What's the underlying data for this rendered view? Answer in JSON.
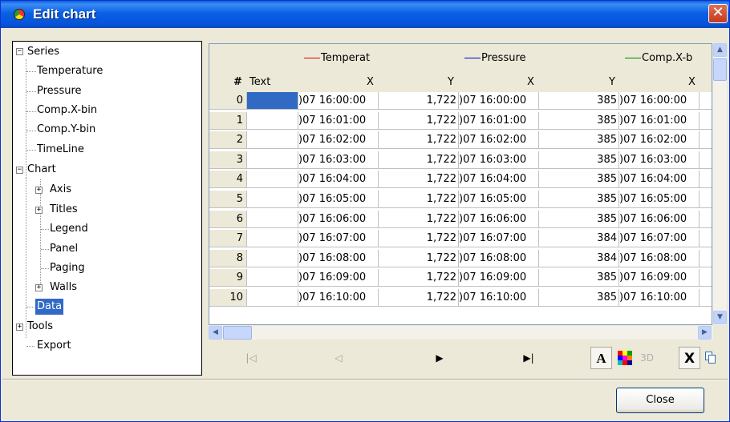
{
  "window": {
    "title": "Edit chart",
    "close_glyph": "✕"
  },
  "tree": {
    "series_label": "Series",
    "series": [
      "Temperature",
      "Pressure",
      "Comp.X-bin",
      "Comp.Y-bin",
      "TimeLine"
    ],
    "chart_label": "Chart",
    "chart_children": [
      "Axis",
      "Titles",
      "Legend",
      "Panel",
      "Paging",
      "Walls"
    ],
    "data_label": "Data",
    "tools_label": "Tools",
    "export_label": "Export"
  },
  "grid": {
    "series_headers": [
      {
        "name": "Temperat",
        "color": "#e00000"
      },
      {
        "name": "Pressure",
        "color": "#0000d0"
      },
      {
        "name": "Comp.X-b",
        "color": "#008000"
      }
    ],
    "col_headers": {
      "hash": "#",
      "text": "Text",
      "x": "X",
      "y": "Y"
    },
    "rows": [
      {
        "n": "0",
        "x1": ")07 16:00:00",
        "y1": "1,722",
        "x2": ")07 16:00:00",
        "y2": "385",
        "x3": ")07 16:00:00"
      },
      {
        "n": "1",
        "x1": ")07 16:01:00",
        "y1": "1,722",
        "x2": ")07 16:01:00",
        "y2": "385",
        "x3": ")07 16:01:00"
      },
      {
        "n": "2",
        "x1": ")07 16:02:00",
        "y1": "1,722",
        "x2": ")07 16:02:00",
        "y2": "385",
        "x3": ")07 16:02:00"
      },
      {
        "n": "3",
        "x1": ")07 16:03:00",
        "y1": "1,722",
        "x2": ")07 16:03:00",
        "y2": "385",
        "x3": ")07 16:03:00"
      },
      {
        "n": "4",
        "x1": ")07 16:04:00",
        "y1": "1,722",
        "x2": ")07 16:04:00",
        "y2": "385",
        "x3": ")07 16:04:00"
      },
      {
        "n": "5",
        "x1": ")07 16:05:00",
        "y1": "1,722",
        "x2": ")07 16:05:00",
        "y2": "385",
        "x3": ")07 16:05:00"
      },
      {
        "n": "6",
        "x1": ")07 16:06:00",
        "y1": "1,722",
        "x2": ")07 16:06:00",
        "y2": "385",
        "x3": ")07 16:06:00"
      },
      {
        "n": "7",
        "x1": ")07 16:07:00",
        "y1": "1,722",
        "x2": ")07 16:07:00",
        "y2": "384",
        "x3": ")07 16:07:00"
      },
      {
        "n": "8",
        "x1": ")07 16:08:00",
        "y1": "1,722",
        "x2": ")07 16:08:00",
        "y2": "384",
        "x3": ")07 16:08:00"
      },
      {
        "n": "9",
        "x1": ")07 16:09:00",
        "y1": "1,722",
        "x2": ")07 16:09:00",
        "y2": "385",
        "x3": ")07 16:09:00"
      },
      {
        "n": "10",
        "x1": ")07 16:10:00",
        "y1": "1,722",
        "x2": ")07 16:10:00",
        "y2": "385",
        "x3": ")07 16:10:00"
      }
    ]
  },
  "navigation": {
    "first_glyph": "|◁",
    "prev_glyph": "◁",
    "next_glyph": "▶",
    "last_glyph": "▶|",
    "font_button": "A",
    "three_d_button": "3D",
    "delete_button": "X"
  },
  "footer": {
    "close_label": "Close"
  }
}
